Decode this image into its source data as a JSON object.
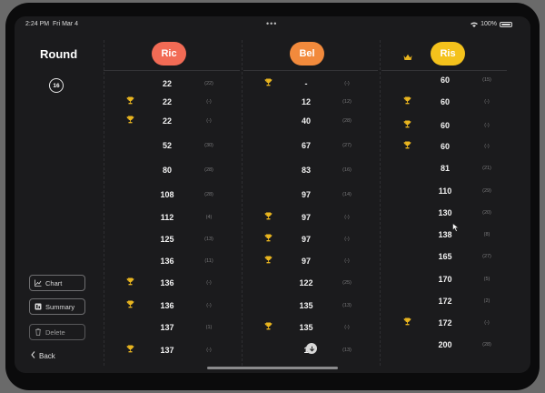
{
  "status": {
    "time": "2:24 PM",
    "date": "Fri Mar 4",
    "battery": "100%"
  },
  "sidebar": {
    "title": "Round",
    "round_number": "16",
    "chart_label": "Chart",
    "summary_label": "Summary",
    "delete_label": "Delete",
    "back_label": "Back"
  },
  "players": [
    {
      "name": "Ric",
      "color": "#f26b55"
    },
    {
      "name": "Bel",
      "color": "#f28a3c"
    },
    {
      "name": "Ris",
      "color": "#f4c21c"
    }
  ],
  "columns": [
    {
      "rows": [
        {
          "score": "22",
          "delta": "(22)",
          "trophy": false
        },
        {
          "score": "22",
          "delta": "(-)",
          "trophy": true
        },
        {
          "score": "22",
          "delta": "(-)",
          "trophy": true
        },
        {
          "score": "52",
          "delta": "(30)",
          "trophy": false
        },
        {
          "score": "80",
          "delta": "(28)",
          "trophy": false
        },
        {
          "score": "108",
          "delta": "(28)",
          "trophy": false
        },
        {
          "score": "112",
          "delta": "(4)",
          "trophy": false
        },
        {
          "score": "125",
          "delta": "(13)",
          "trophy": false
        },
        {
          "score": "136",
          "delta": "(11)",
          "trophy": false
        },
        {
          "score": "136",
          "delta": "(-)",
          "trophy": true
        },
        {
          "score": "136",
          "delta": "(-)",
          "trophy": true
        },
        {
          "score": "137",
          "delta": "(1)",
          "trophy": false
        },
        {
          "score": "137",
          "delta": "(-)",
          "trophy": true
        }
      ]
    },
    {
      "rows": [
        {
          "score": "-",
          "delta": "(-)",
          "trophy": true
        },
        {
          "score": "12",
          "delta": "(12)",
          "trophy": false
        },
        {
          "score": "40",
          "delta": "(28)",
          "trophy": false
        },
        {
          "score": "67",
          "delta": "(27)",
          "trophy": false
        },
        {
          "score": "83",
          "delta": "(16)",
          "trophy": false
        },
        {
          "score": "97",
          "delta": "(14)",
          "trophy": false
        },
        {
          "score": "97",
          "delta": "(-)",
          "trophy": true
        },
        {
          "score": "97",
          "delta": "(-)",
          "trophy": true
        },
        {
          "score": "97",
          "delta": "(-)",
          "trophy": true
        },
        {
          "score": "122",
          "delta": "(25)",
          "trophy": false
        },
        {
          "score": "135",
          "delta": "(13)",
          "trophy": false
        },
        {
          "score": "135",
          "delta": "(-)",
          "trophy": true
        },
        {
          "score": "1",
          "delta": "(13)",
          "trophy": false
        }
      ]
    },
    {
      "rows": [
        {
          "score": "60",
          "delta": "(15)",
          "trophy": false
        },
        {
          "score": "60",
          "delta": "(-)",
          "trophy": true
        },
        {
          "score": "60",
          "delta": "(-)",
          "trophy": true
        },
        {
          "score": "60",
          "delta": "(-)",
          "trophy": true
        },
        {
          "score": "81",
          "delta": "(21)",
          "trophy": false
        },
        {
          "score": "110",
          "delta": "(29)",
          "trophy": false
        },
        {
          "score": "130",
          "delta": "(20)",
          "trophy": false
        },
        {
          "score": "138",
          "delta": "(8)",
          "trophy": false
        },
        {
          "score": "165",
          "delta": "(27)",
          "trophy": false
        },
        {
          "score": "170",
          "delta": "(5)",
          "trophy": false
        },
        {
          "score": "172",
          "delta": "(2)",
          "trophy": false
        },
        {
          "score": "172",
          "delta": "(-)",
          "trophy": true
        },
        {
          "score": "200",
          "delta": "(28)",
          "trophy": false
        }
      ]
    }
  ],
  "icons": {
    "trophy": "trophy-icon",
    "crown": "crown-icon",
    "chart": "chart-icon",
    "summary": "summary-icon",
    "delete": "trash-icon",
    "back": "chevron-left-icon"
  },
  "colors": {
    "trophy": "#e9b51f",
    "background": "#1b1b1d",
    "text": "#f2f2f2",
    "muted": "#7a7a7c"
  }
}
